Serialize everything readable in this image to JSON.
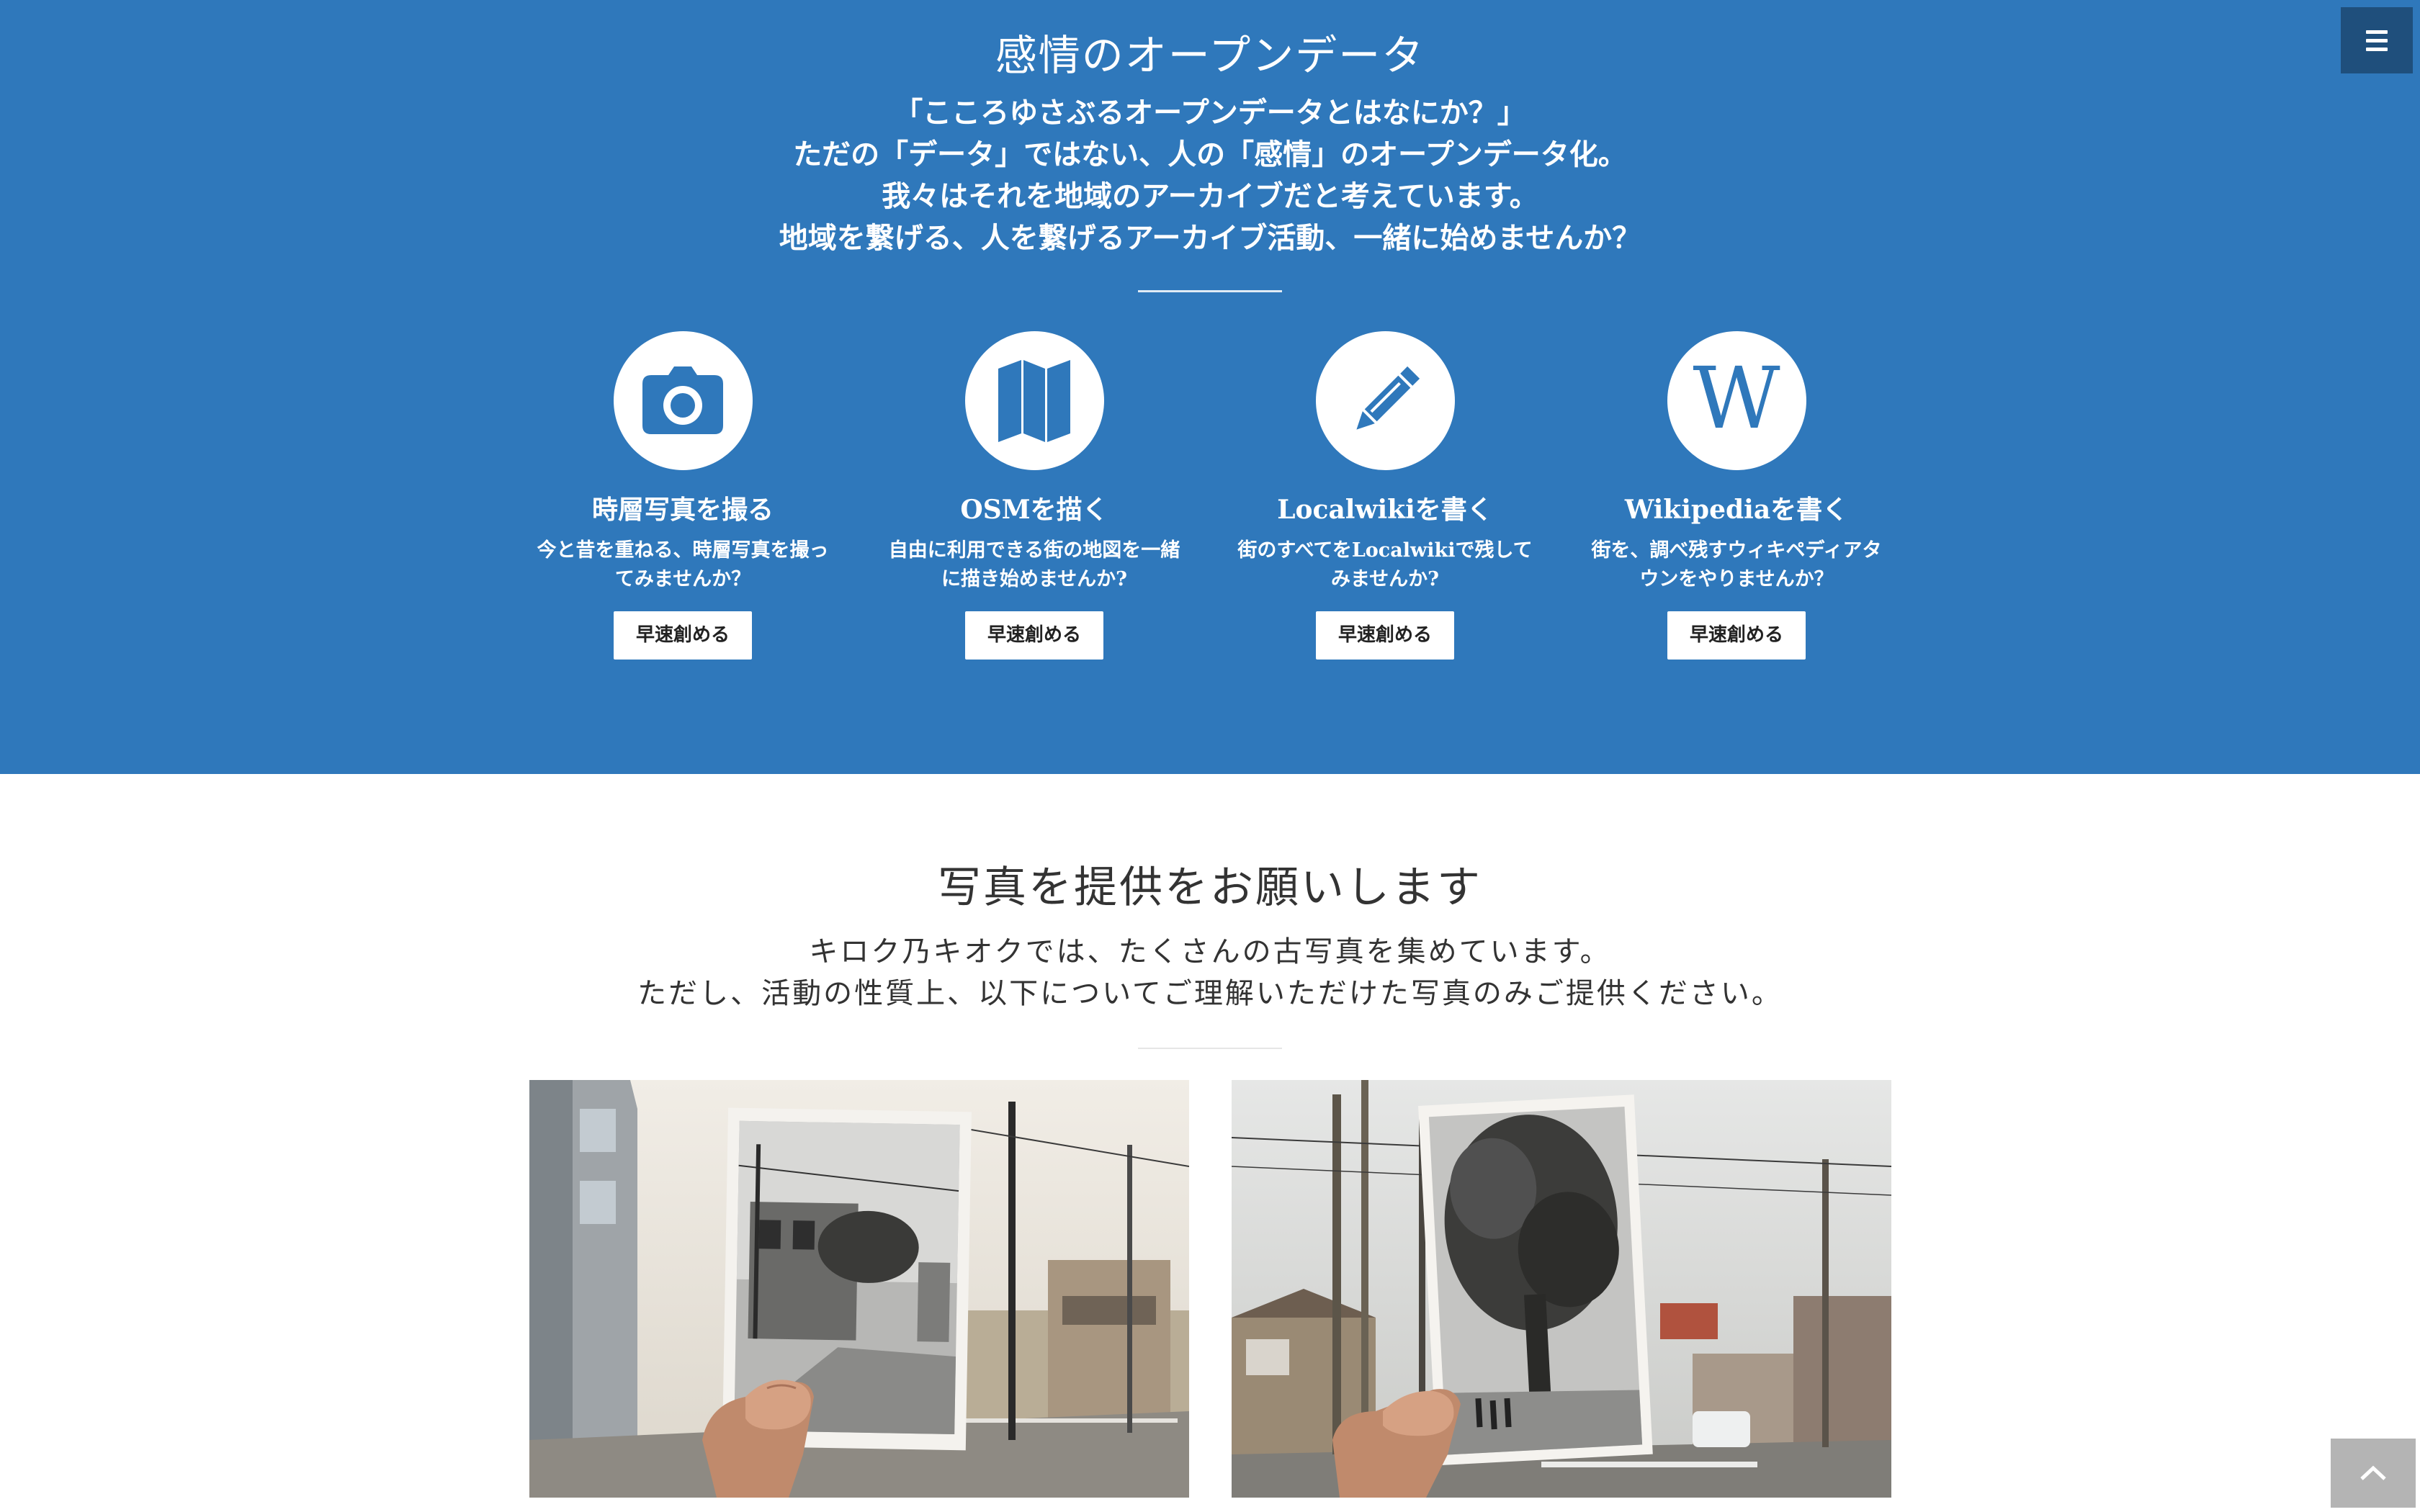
{
  "hero": {
    "title": "感情のオープンデータ",
    "lead": [
      "「こころゆさぶるオープンデータとはなにか？」",
      "ただの「データ」ではない、人の「感情」のオープンデータ化。",
      "我々はそれを地域のアーカイブだと考えています。",
      "地域を繋げる、人を繋げるアーカイブ活動、一緒に始めませんか？"
    ],
    "accent_color": "#2f78bb"
  },
  "menu": {
    "icon": "hamburger-menu-icon"
  },
  "features": [
    {
      "icon": "camera-icon",
      "title": "時層写真を撮る",
      "desc": "今と昔を重ねる、時層写真を撮ってみませんか？",
      "button": "早速創める"
    },
    {
      "icon": "map-icon",
      "title": "OSMを描く",
      "desc": "自由に利用できる街の地図を一緒に描き始めませんか?",
      "button": "早速創める"
    },
    {
      "icon": "pencil-icon",
      "title": "Localwikiを書く",
      "desc": "街のすべてをLocalwikiで残してみませんか?",
      "button": "早速創める"
    },
    {
      "icon": "wikipedia-icon",
      "title": "Wikipediaを書く",
      "desc": "街を、調べ残すウィキペディアタウンをやりませんか？",
      "button": "早速創める"
    }
  ],
  "photos": {
    "title": "写真を提供をお願いします",
    "lead": [
      "キロク乃キオクでは、たくさんの古写真を集めています。",
      "ただし、活動の性質上、以下についてご理解いただけた写真のみご提供ください。"
    ]
  },
  "scroll_top": {
    "icon": "chevron-up-icon"
  }
}
